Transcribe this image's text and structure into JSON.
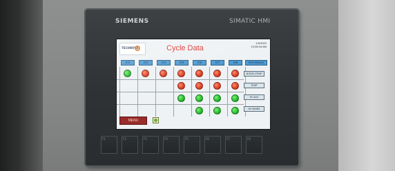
{
  "panel": {
    "brand_left": "SIEMENS",
    "brand_right": "SIMATIC HMI"
  },
  "screen": {
    "logo_text": "TECHNOVA",
    "title": "Cycle Data",
    "date": "1/9/2020",
    "time": "10:08:44 AM",
    "stations": [
      "ST2",
      "ST3",
      "ST4",
      "ST5",
      "ST6",
      "ST7",
      "ST8"
    ],
    "result_header": "TEST RESULT",
    "rows": [
      [
        "green",
        "red",
        "red",
        "red",
        "red",
        "red",
        "red"
      ],
      [
        "",
        "",
        "",
        "red",
        "red",
        "red",
        "red"
      ],
      [
        "",
        "",
        "",
        "green",
        "green",
        "green",
        "green"
      ],
      [
        "",
        "",
        "",
        "",
        "green",
        "green",
        "green"
      ]
    ],
    "side_buttons": [
      "MODEL/TEMP",
      "TEMP",
      "HV AUX",
      "HV MAINS"
    ],
    "bottom_button": "MENU"
  },
  "fkeys": [
    "F1",
    "F2",
    "F3",
    "F4",
    "F5",
    "F6",
    "F7",
    "F8"
  ],
  "colors": {
    "lamp_red": "#e0452a",
    "lamp_green": "#2cc131",
    "header_blue": "#4f9bd3",
    "title_red": "#e0302c"
  }
}
